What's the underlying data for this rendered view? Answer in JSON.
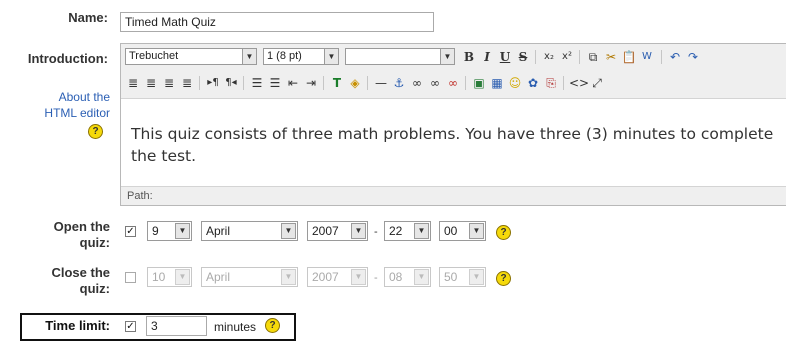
{
  "form": {
    "name_label": "Name:",
    "name_value": "Timed Math Quiz",
    "intro_label": "Introduction:",
    "about_html_editor": "About the HTML editor",
    "open_label": "Open the quiz:",
    "close_label": "Close the quiz:",
    "time_limit_label": "Time limit:",
    "time_limit_value": "3",
    "minutes_label": "minutes"
  },
  "editor": {
    "font": "Trebuchet",
    "size": "1 (8 pt)",
    "format": "",
    "content": "This quiz consists of three math problems. You have three (3) minutes to complete the test.",
    "path_label": "Path:"
  },
  "open_quiz": {
    "checked": true,
    "day": "9",
    "month": "April",
    "year": "2007",
    "hour": "22",
    "minute": "00",
    "sep": "-"
  },
  "close_quiz": {
    "checked": false,
    "day": "10",
    "month": "April",
    "year": "2007",
    "hour": "08",
    "minute": "50",
    "sep": "-"
  },
  "help": "?",
  "icons": [
    "bold",
    "italic",
    "underline",
    "strikethrough",
    "subscript",
    "superscript",
    "copy",
    "cut",
    "paste",
    "paste-word",
    "undo",
    "redo",
    "align-left",
    "align-center",
    "align-right",
    "justify",
    "ltr",
    "rtl",
    "ordered-list",
    "unordered-list",
    "outdent",
    "indent",
    "text-color",
    "bg-color",
    "horizontal-rule",
    "anchor",
    "link",
    "unlink",
    "nolink",
    "image",
    "table",
    "smiley",
    "special-char",
    "search-replace",
    "html-source",
    "fullscreen"
  ]
}
